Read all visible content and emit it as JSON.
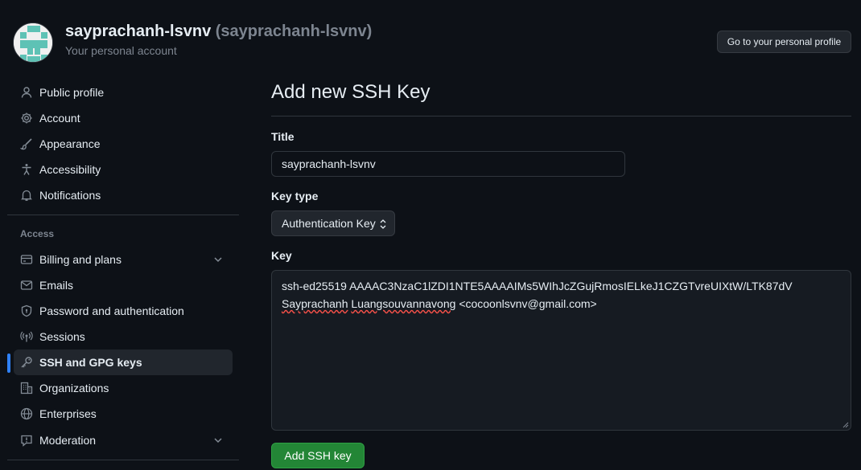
{
  "header": {
    "display_name": "sayprachanh-lsvnv",
    "login": "(sayprachanh-lsvnv)",
    "subtitle": "Your personal account",
    "profile_button": "Go to your personal profile"
  },
  "sidebar": {
    "top_items": [
      {
        "label": "Public profile",
        "icon": "person-icon"
      },
      {
        "label": "Account",
        "icon": "gear-icon"
      },
      {
        "label": "Appearance",
        "icon": "paintbrush-icon"
      },
      {
        "label": "Accessibility",
        "icon": "accessibility-icon"
      },
      {
        "label": "Notifications",
        "icon": "bell-icon"
      }
    ],
    "access_heading": "Access",
    "access_items": [
      {
        "label": "Billing and plans",
        "icon": "credit-card-icon",
        "expandable": true
      },
      {
        "label": "Emails",
        "icon": "mail-icon"
      },
      {
        "label": "Password and authentication",
        "icon": "shield-lock-icon"
      },
      {
        "label": "Sessions",
        "icon": "broadcast-icon"
      },
      {
        "label": "SSH and GPG keys",
        "icon": "key-icon",
        "active": true
      },
      {
        "label": "Organizations",
        "icon": "organization-icon"
      },
      {
        "label": "Enterprises",
        "icon": "globe-icon"
      },
      {
        "label": "Moderation",
        "icon": "report-icon",
        "expandable": true
      }
    ]
  },
  "main": {
    "page_title": "Add new SSH Key",
    "title_label": "Title",
    "title_value": "sayprachanh-lsvnv",
    "key_type_label": "Key type",
    "key_type_value": "Authentication Key",
    "key_label": "Key",
    "key_value_line1": "ssh-ed25519 AAAAC3NzaC1lZDI1NTE5AAAAIMs5WIhJcZGujRmosIELkeJ1CZGTvreUIXtW/LTK87dV",
    "key_value_word1": "Sayprachanh",
    "key_value_word2": "Luangsouvannavong",
    "key_value_email": "<cocoonlsvnv@gmail.com>",
    "submit_label": "Add SSH key"
  },
  "colors": {
    "background": "#0d1117",
    "accent_blue": "#2f81f7",
    "button_green": "#238636",
    "muted_text": "#7d8590"
  }
}
